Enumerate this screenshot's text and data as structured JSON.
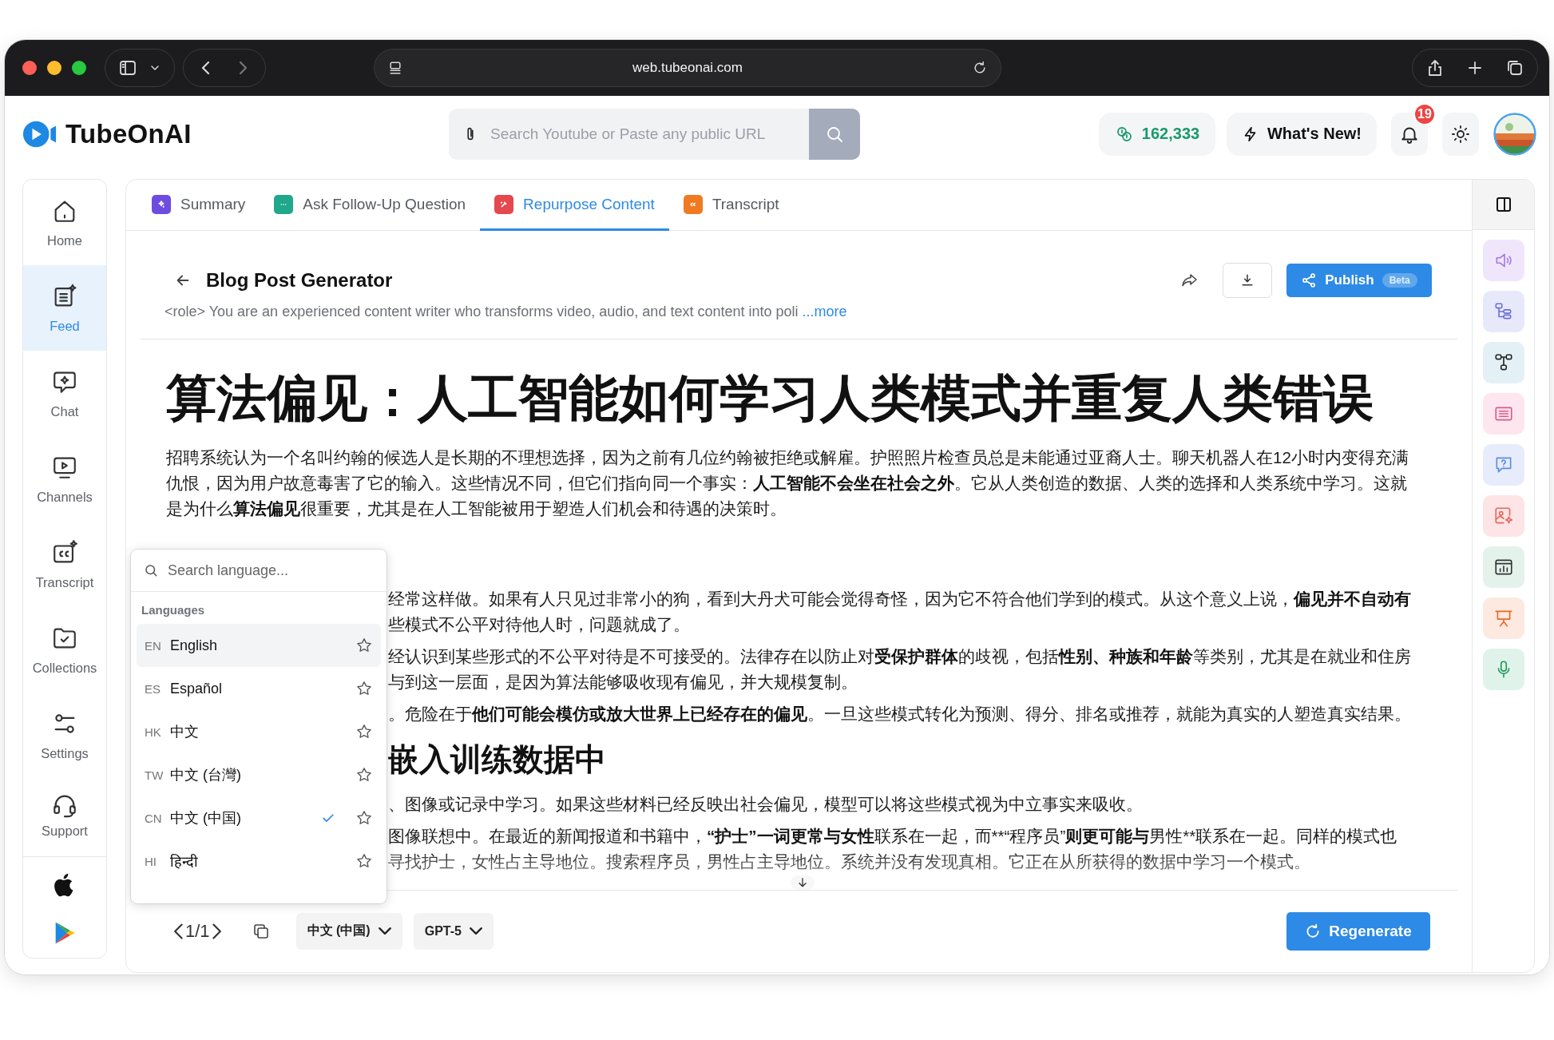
{
  "browser": {
    "url": "web.tubeonai.com"
  },
  "header": {
    "logo": "TubeOnAI",
    "search": {
      "placeholder": "Search Youtube or Paste any public URL"
    },
    "credits": "162,333",
    "whats_new": "What's New!",
    "notifications": "19"
  },
  "sidebar": {
    "items": [
      {
        "label": "Home",
        "selected": false
      },
      {
        "label": "Feed",
        "selected": true
      },
      {
        "label": "Chat",
        "selected": false
      },
      {
        "label": "Channels",
        "selected": false
      },
      {
        "label": "Transcript",
        "selected": false
      },
      {
        "label": "Collections",
        "selected": false
      },
      {
        "label": "Settings",
        "selected": false
      },
      {
        "label": "Support",
        "selected": false
      }
    ]
  },
  "tabs": [
    {
      "label": "Summary",
      "selected": false,
      "color": "#6e4ce0"
    },
    {
      "label": "Ask Follow-Up Question",
      "selected": false,
      "color": "#1fa88a"
    },
    {
      "label": "Repurpose Content",
      "selected": true,
      "color": "#e5484d"
    },
    {
      "label": "Transcript",
      "selected": false,
      "color": "#f07a22"
    }
  ],
  "generator": {
    "title": "Blog Post Generator",
    "description": "<role> You are an experienced content writer who transforms video, audio, and text content into poli",
    "more_link": "...more",
    "publish": {
      "label": "Publish",
      "badge": "Beta"
    }
  },
  "article": {
    "title": "算法偏见：人工智能如何学习人类模式并重复人类错误",
    "blocks": [
      {
        "kind": "paragraph",
        "lines": [
          [
            {
              "text": "招聘系统认为一个名叫约翰的候选人是长期的不理想选择，因为之前有几位约翰被拒绝或解雇。护照照片检查员总是未能通过亚裔人士。聊天机器人在12小时内变得充满",
              "bold": false
            }
          ],
          [
            {
              "text": "仇恨，因为用户故意毒害了它的输入。这些情况不同，但它们指向同一个事实：",
              "bold": false
            },
            {
              "text": "人工智能不会坐在社会之外",
              "bold": true
            },
            {
              "text": "。它从人类创造的数据、人类的选择和人类系统中学习。这就",
              "bold": false
            }
          ],
          [
            {
              "text": "是为什么",
              "bold": false
            },
            {
              "text": "算法偏见",
              "bold": true
            },
            {
              "text": "很重要，尤其是在人工智能被用于塑造人们机会和待遇的决策时。",
              "bold": false
            }
          ]
        ]
      },
      {
        "kind": "paragraph",
        "lines": [
          [
            {
              "text": "经常这样做。如果有人只见过非常小的狗，看到大丹犬可能会觉得奇怪，因为它不符合他们学到的模式。从这个意义上说，",
              "bold": false
            },
            {
              "text": "偏见并不自动有",
              "bold": true
            }
          ],
          [
            {
              "text": "些模式不公平对待他人时，问题就成了。",
              "bold": false
            }
          ]
        ]
      },
      {
        "kind": "paragraph",
        "lines": [
          [
            {
              "text": "经认识到某些形式的不公平对待是不可接受的。法律存在以防止对",
              "bold": false
            },
            {
              "text": "受保护群体",
              "bold": true
            },
            {
              "text": "的歧视，包括",
              "bold": false
            },
            {
              "text": "性别、种族和年龄",
              "bold": true
            },
            {
              "text": "等类别，尤其是在就业和住房",
              "bold": false
            }
          ],
          [
            {
              "text": "与到这一层面，是因为算法能够吸收现有偏见，并大规模复制。",
              "bold": false
            }
          ]
        ]
      },
      {
        "kind": "paragraph",
        "lines": [
          [
            {
              "text": "。危险在于",
              "bold": false
            },
            {
              "text": "他们可能会模仿或放大世界上已经存在的偏见",
              "bold": true
            },
            {
              "text": "。一旦这些模式转化为预测、得分、排名或推荐，就能为真实的人塑造真实结果。",
              "bold": false
            }
          ]
        ]
      },
      {
        "kind": "heading",
        "text": "嵌入训练数据中"
      },
      {
        "kind": "paragraph",
        "lines": [
          [
            {
              "text": "、图像或记录中学习。如果这些材料已经反映出社会偏见，模型可以将这些模式视为中立事实来吸收。",
              "bold": false
            }
          ]
        ]
      },
      {
        "kind": "paragraph",
        "lines": [
          [
            {
              "text": "图像联想中。在最近的新闻报道和书籍中，",
              "bold": false
            },
            {
              "text": "“护士”一词更常与女性",
              "bold": true
            },
            {
              "text": "联系在一起，而**“程序员”",
              "bold": false
            },
            {
              "text": "则更可能与",
              "bold": true
            },
            {
              "text": "男性**联系在一起。同样的模式也",
              "bold": false
            }
          ],
          [
            {
              "text": "寻找护士，女性占主导地位。搜索程序员，男性占主导地位。系统并没有发现真相。它正在从所获得的数据中学习一个模式。",
              "bold": false
            }
          ]
        ]
      }
    ]
  },
  "language_menu": {
    "search": {
      "placeholder": "Search language..."
    },
    "section": "Languages",
    "items": [
      {
        "code": "EN",
        "name": "English",
        "highlighted": true,
        "selected": false
      },
      {
        "code": "ES",
        "name": "Español",
        "highlighted": false,
        "selected": false
      },
      {
        "code": "HK",
        "name": "中文",
        "highlighted": false,
        "selected": false
      },
      {
        "code": "TW",
        "name": "中文 (台灣)",
        "highlighted": false,
        "selected": false
      },
      {
        "code": "CN",
        "name": "中文 (中国)",
        "highlighted": false,
        "selected": true
      },
      {
        "code": "HI",
        "name": "हिन्दी",
        "highlighted": false,
        "selected": false
      }
    ]
  },
  "footer": {
    "page": "1/1",
    "language": "中文 (中国)",
    "model": "GPT-5",
    "regenerate": "Regenerate"
  }
}
